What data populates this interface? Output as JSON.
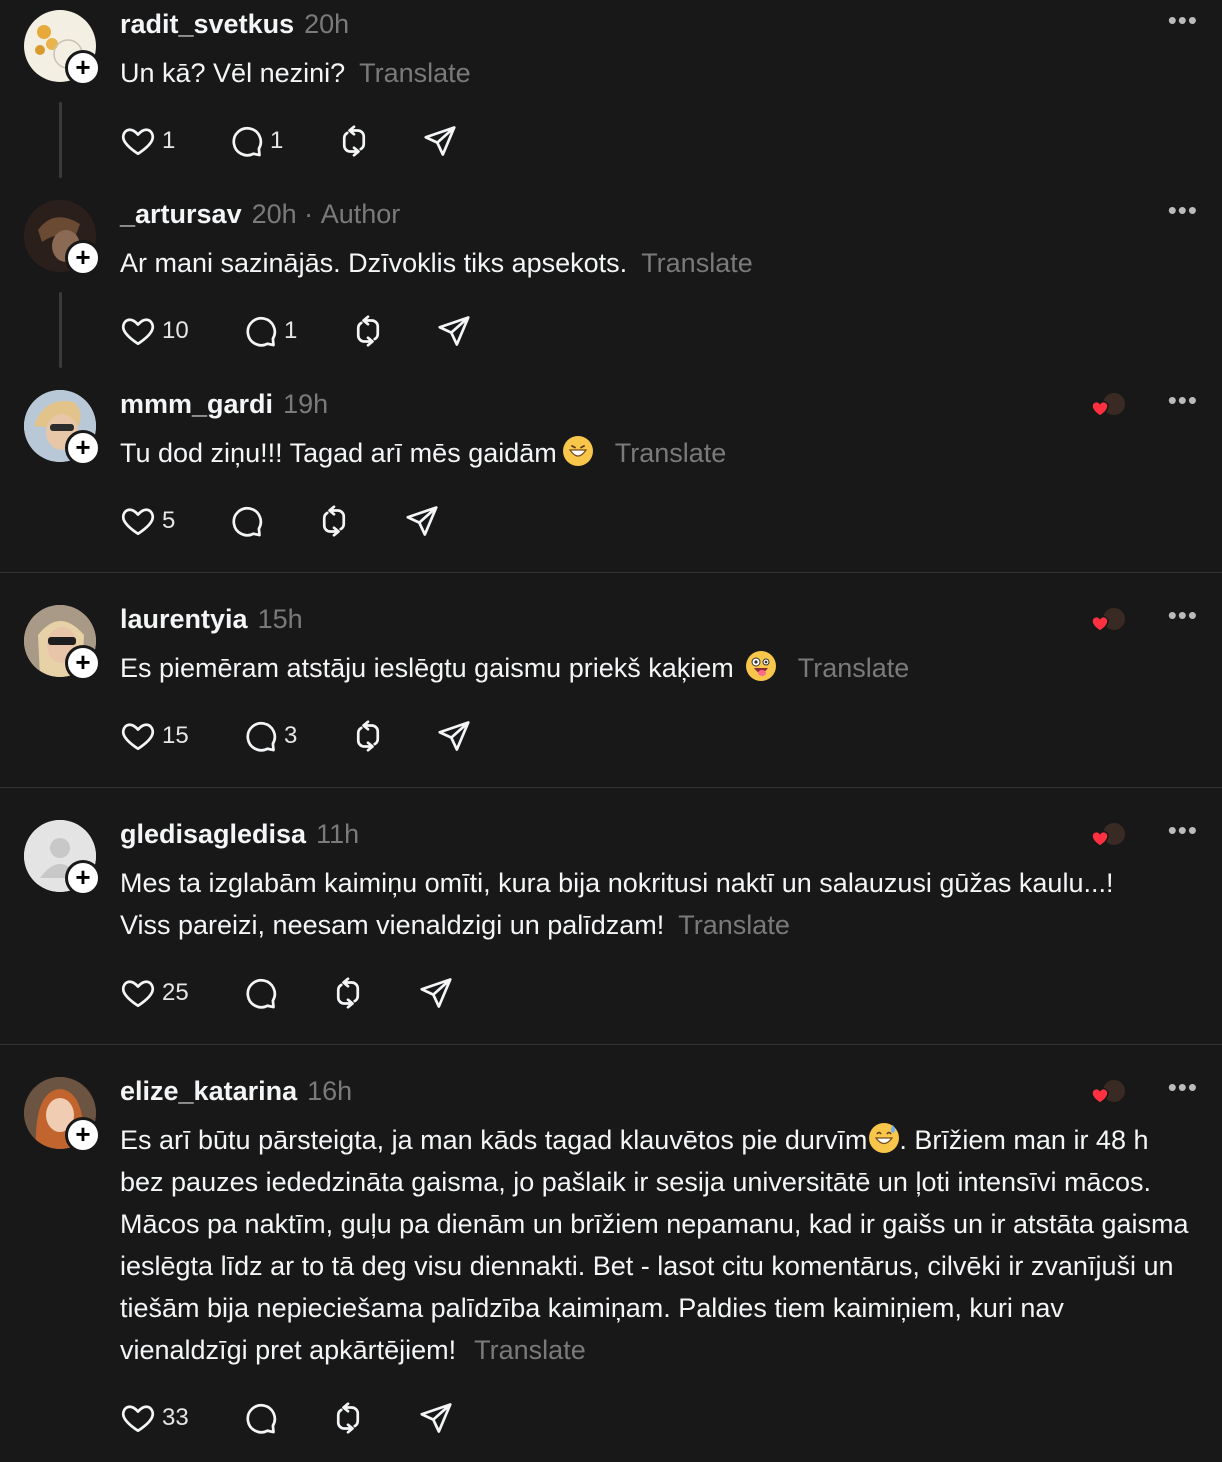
{
  "ui": {
    "translate_label": "Translate",
    "author_label": "Author"
  },
  "posts": [
    {
      "username": "radit_svetkus",
      "time": "20h",
      "text": "Un kā? Vēl nezini?",
      "likes": "1",
      "replies": "1"
    },
    {
      "username": "_artursav",
      "time": "20h",
      "separator": "·",
      "text": "Ar mani sazinājās. Dzīvoklis tiks apsekots.",
      "likes": "10",
      "replies": "1"
    },
    {
      "username": "mmm_gardi",
      "time": "19h",
      "text": "Tu dod ziņu!!! Tagad arī mēs gaidām",
      "likes": "5",
      "replies": ""
    },
    {
      "username": "laurentyia",
      "time": "15h",
      "text": "Es piemēram atstāju ieslēgtu gaismu priekš kaķiem",
      "likes": "15",
      "replies": "3"
    },
    {
      "username": "gledisagledisa",
      "time": "11h",
      "text": "Mes ta izglabām kaimiņu omīti, kura bija nokritusi naktī un salauzusi gūžas kaulu...! Viss pareizi, neesam vienaldzigi un palīdzam!",
      "likes": "25",
      "replies": ""
    },
    {
      "username": "elize_katarina",
      "time": "16h",
      "text_a": "Es arī būtu pārsteigta, ja man kāds tagad klauvētos pie durvīm",
      "text_b": ". Brīžiem man ir 48 h bez pauzes iededzināta gaisma, jo pašlaik ir sesija universitātē un ļoti intensīvi mācos. Mācos pa naktīm, guļu pa dienām un brīžiem nepamanu, kad ir gaišs un ir atstāta gaisma ieslēgta līdz ar to tā deg visu diennakti. Bet - lasot citu komentārus, cilvēki ir zvanījuši un tiešām bija nepieciešama palīdzība kaimiņam. Paldies tiem kaimiņiem, kuri nav vienaldzīgi pret apkārtējiem!",
      "likes": "33",
      "replies": ""
    }
  ],
  "colors": {
    "background": "#181818",
    "text": "#f3f5f7",
    "muted": "#7a7a7a",
    "like_heart": "#ff3040"
  },
  "icons": [
    "heart-icon",
    "comment-icon",
    "repost-icon",
    "share-icon",
    "more-icon",
    "follow-plus-icon",
    "author-liked-icon"
  ]
}
